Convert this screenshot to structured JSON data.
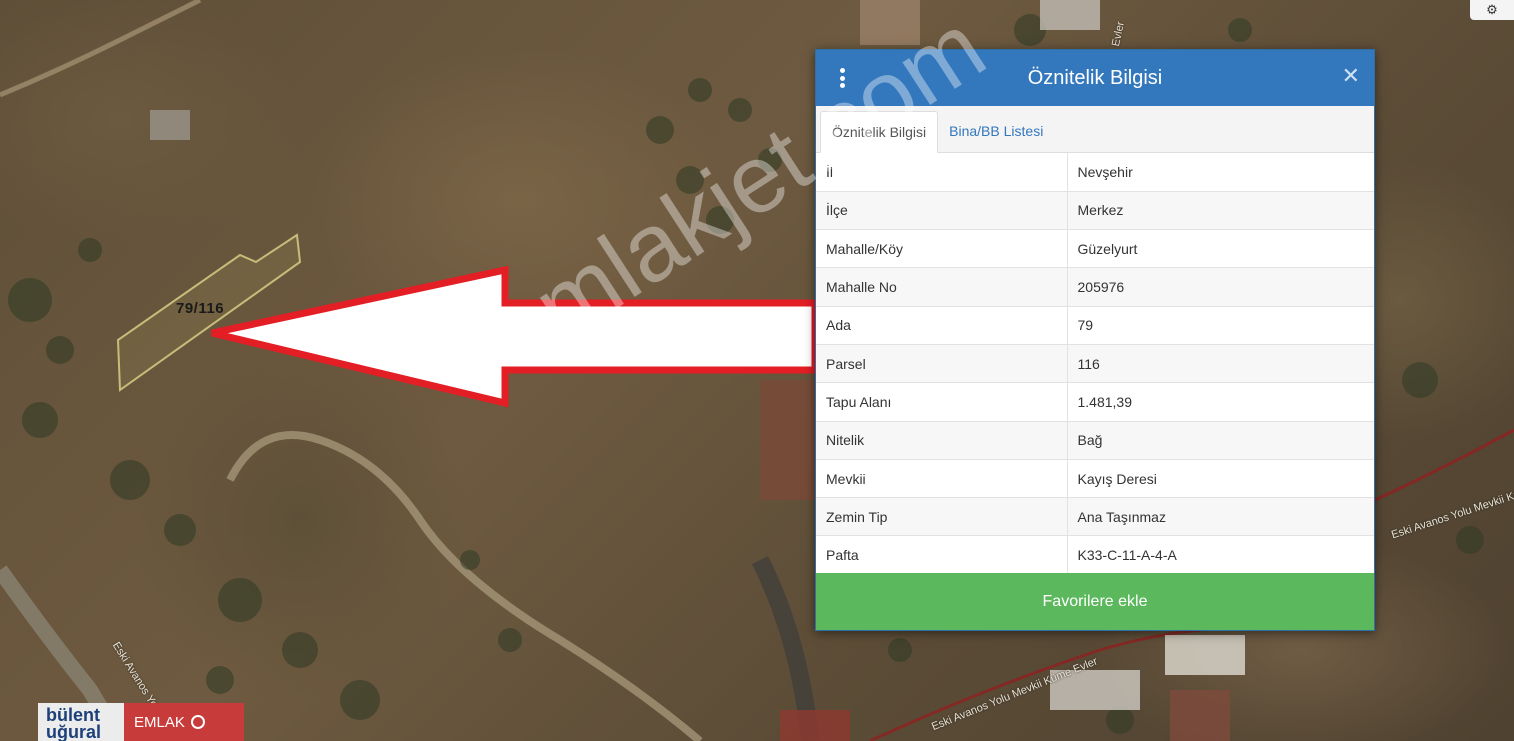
{
  "map": {
    "parcel_label": "79/116",
    "road_labels": [
      "Eski Avanos Yolu",
      "Eski Avanos Yolu Mevkii Küme Evler",
      "Eski Avanos Yolu Mevkii Küme Evler",
      "Evler"
    ]
  },
  "watermark": "emlakjet.com",
  "logo": {
    "line1": "bülent",
    "line2": "uğural",
    "right": "EMLAK"
  },
  "dialog": {
    "title": "Öznitelik Bilgisi",
    "tabs": [
      {
        "label": "Öznitelik Bilgisi",
        "active": true
      },
      {
        "label": "Bina/BB Listesi",
        "active": false
      }
    ],
    "rows": [
      {
        "key": "İl",
        "value": "Nevşehir"
      },
      {
        "key": "İlçe",
        "value": "Merkez"
      },
      {
        "key": "Mahalle/Köy",
        "value": "Güzelyurt"
      },
      {
        "key": "Mahalle No",
        "value": "205976"
      },
      {
        "key": "Ada",
        "value": "79"
      },
      {
        "key": "Parsel",
        "value": "116"
      },
      {
        "key": "Tapu Alanı",
        "value": "1.481,39"
      },
      {
        "key": "Nitelik",
        "value": "Bağ"
      },
      {
        "key": "Mevkii",
        "value": "Kayış Deresi"
      },
      {
        "key": "Zemin Tip",
        "value": "Ana Taşınmaz"
      },
      {
        "key": "Pafta",
        "value": "K33-C-11-A-4-A"
      }
    ],
    "favorite_button": "Favorilere ekle"
  },
  "icons": {
    "menu": "kebab-menu-icon",
    "close": "close-icon",
    "settings": "gear-icon"
  },
  "colors": {
    "header": "#3377bd",
    "favorite": "#5cb85c",
    "arrow": "#e31e24"
  }
}
